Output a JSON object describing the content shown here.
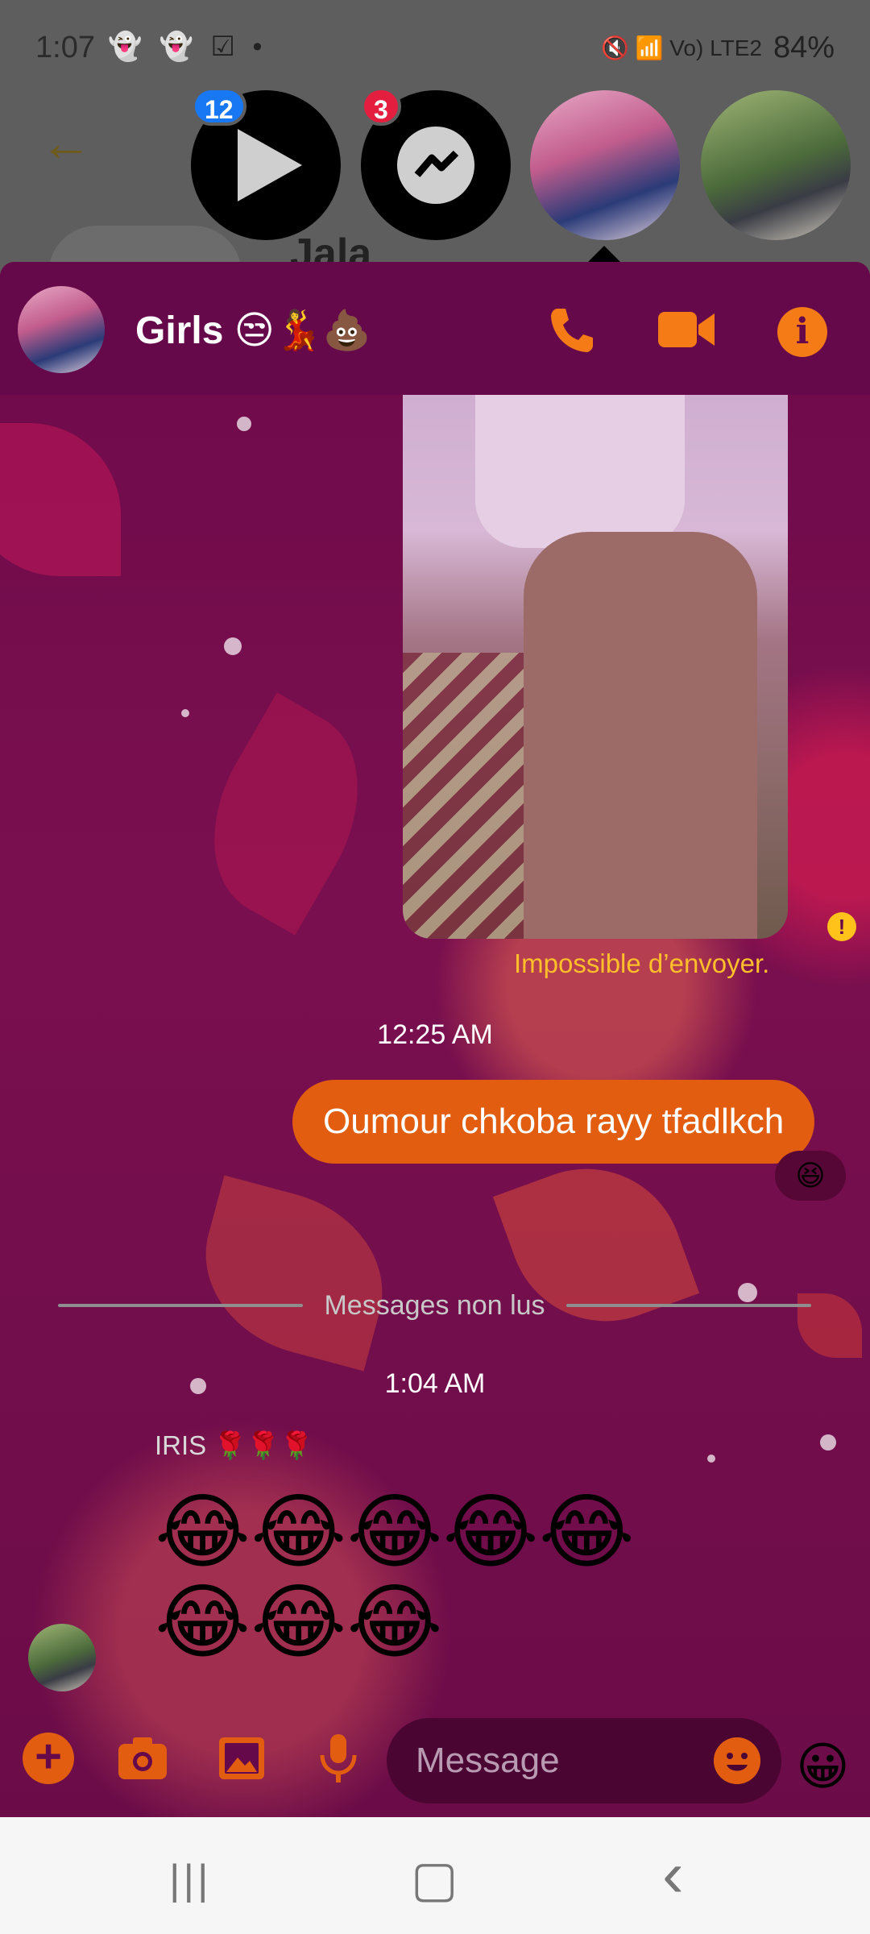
{
  "status_bar": {
    "time": "1:07",
    "left_icons": "👻 👻 ☑ •",
    "right_icons": "🔇 📶 Vo) LTE2",
    "battery": "84%"
  },
  "background_chat": {
    "back_icon": "←",
    "name": "Jala"
  },
  "chat_heads": {
    "video_badge": "12",
    "messenger_badge": "3"
  },
  "header": {
    "title": "Girls 😒💃💩",
    "info_icon": "i"
  },
  "messages": {
    "error_text": "Impossible d’envoyer.",
    "warning_icon": "!",
    "time_1": "12:25 AM",
    "sent_text": "Oumour chkoba rayy tfadlkch",
    "reaction": "😆",
    "unread_label": "Messages non lus",
    "time_2": "1:04 AM",
    "sender_name": "IRIS 🌹🌹🌹",
    "emoji_text": "😂😂😂😂😂😂😂😂"
  },
  "composer": {
    "plus_icon": "+",
    "placeholder": "Message",
    "like_emoji": "😀"
  },
  "nav_bar": {
    "recents": "|||",
    "home": "▢",
    "back": "‹"
  },
  "colors": {
    "accent": "#e25d0f",
    "chat_bg": "#6e0a4a",
    "error": "#ffbf2a"
  }
}
